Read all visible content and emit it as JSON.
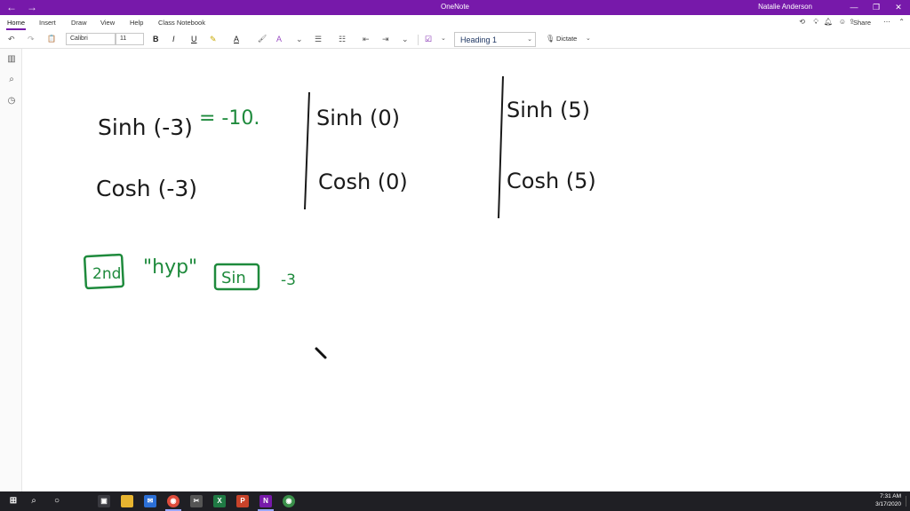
{
  "window": {
    "title": "OneNote",
    "user": "Natalie Anderson",
    "nav_back": "←",
    "nav_forward": "→",
    "minimize": "—",
    "restore": "❐",
    "close": "✕"
  },
  "tabs": [
    "Home",
    "Insert",
    "Draw",
    "View",
    "Help",
    "Class Notebook"
  ],
  "active_tab": "Home",
  "share_label": "Share",
  "toolbar": {
    "undo": "↶",
    "redo": "↷",
    "clipboard": "📋",
    "font_name": "Calibri",
    "font_size": "11",
    "bold": "B",
    "italic": "I",
    "underline": "U",
    "highlight": "✎",
    "font_color": "A",
    "format_painter": "🖌",
    "clear": "A",
    "more": "⌄",
    "bullets": "☰",
    "numbering": "☷",
    "outdent": "⇤",
    "indent": "⇥",
    "more2": "⌄",
    "todo": "☑",
    "style_value": "Heading 1",
    "dictate_label": "Dictate"
  },
  "rail": {
    "notebooks_icon": "notebooks-icon",
    "search_icon": "search-icon",
    "recent_icon": "recent-icon"
  },
  "ink": {
    "sinh_neg3": "Sinh (-3)",
    "sinh_result": "= -10.",
    "cosh_neg3": "Cosh (-3)",
    "sinh_0": "Sinh (0)",
    "cosh_0": "Cosh (0)",
    "sinh_5": "Sinh (5)",
    "cosh_5": "Cosh (5)",
    "key_2nd": "2nd",
    "hyp": "\"hyp\"",
    "key_sin": "Sin",
    "neg3": "-3"
  },
  "colors": {
    "accent": "#7719aa",
    "ink_black": "#1a1a1a",
    "ink_green": "#1e8a3c"
  },
  "taskbar": {
    "time": "7:31 AM",
    "date": "3/17/2020"
  }
}
